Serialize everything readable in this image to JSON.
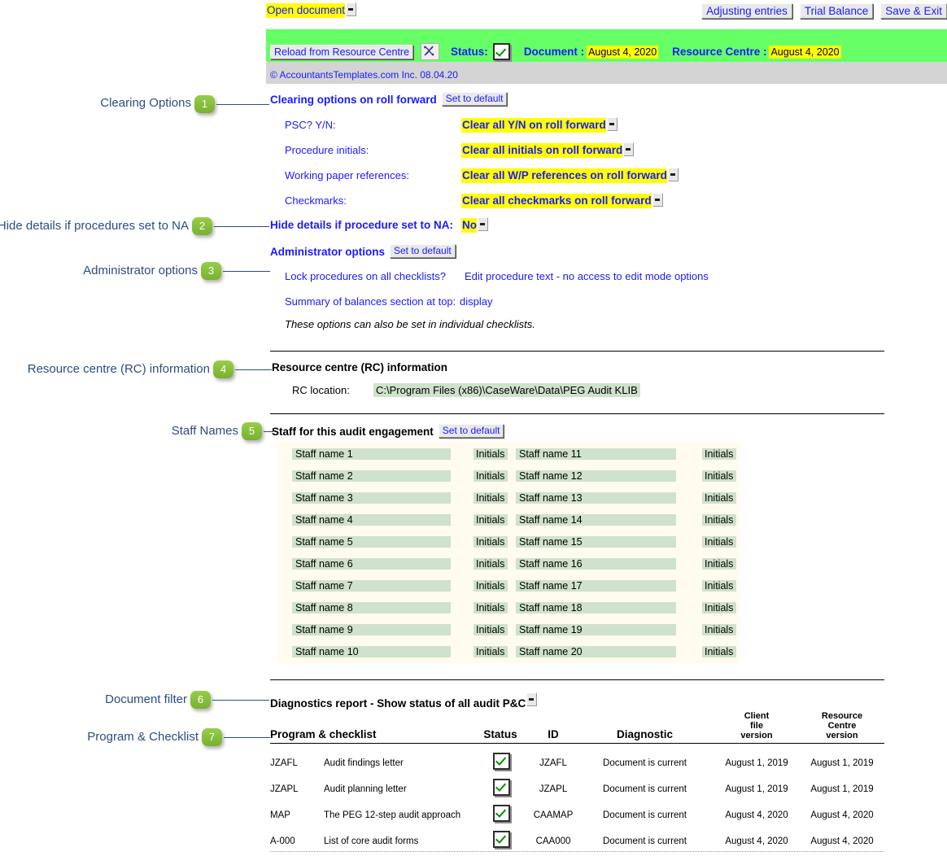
{
  "toolbar": {
    "open_document": "Open document",
    "adjusting_entries": "Adjusting entries",
    "trial_balance": "Trial Balance",
    "save_exit": "Save & Exit"
  },
  "status_band": {
    "reload_button": "Reload from Resource Centre",
    "tool_icon": "dna-helix-icon",
    "status_label": "Status:",
    "status_checked": true,
    "document_label": "Document :",
    "document_date": "August 4, 2020",
    "resource_centre_label": "Resource Centre :",
    "resource_centre_date": "August 4, 2020",
    "copyright": "© AccountantsTemplates.com Inc. 08.04.20",
    "band_color": "#66ff66",
    "highlight_color": "#ffff00"
  },
  "callouts": [
    {
      "n": "1",
      "label": "Clearing Options"
    },
    {
      "n": "2",
      "label": "Hide details if procedures set to NA"
    },
    {
      "n": "3",
      "label": "Administrator options"
    },
    {
      "n": "4",
      "label": "Resource centre (RC) information"
    },
    {
      "n": "5",
      "label": "Staff Names"
    },
    {
      "n": "6",
      "label": "Document filter"
    },
    {
      "n": "7",
      "label": "Program & Checklist"
    }
  ],
  "clearing": {
    "heading": "Clearing options on roll forward",
    "set_default": "Set to default",
    "rows": [
      {
        "label": "PSC? Y/N:",
        "value": "Clear all Y/N on roll forward"
      },
      {
        "label": "Procedure initials:",
        "value": "Clear all initials on roll forward"
      },
      {
        "label": "Working paper references:",
        "value": "Clear all W/P references on roll forward"
      },
      {
        "label": "Checkmarks:",
        "value": "Clear all checkmarks on roll forward"
      }
    ]
  },
  "hide_details": {
    "label": "Hide details if procedure set to NA:",
    "value": "No"
  },
  "admin": {
    "heading": "Administrator options",
    "set_default": "Set to default",
    "rows": [
      {
        "label": "Lock procedures on all checklists?",
        "value": "Edit procedure text - no access to edit mode options"
      },
      {
        "label": "Summary of  balances section at top:",
        "value": "display"
      }
    ],
    "note": "These options can also be set in individual checklists."
  },
  "rc": {
    "heading": "Resource centre (RC) information",
    "location_label": "RC location:",
    "location_value": "C:\\Program Files (x86)\\CaseWare\\Data\\PEG Audit KLIB"
  },
  "staff": {
    "heading": "Staff for this audit engagement",
    "set_default": "Set to default",
    "initials_placeholder": "Initials",
    "left_column": [
      "Staff name 1",
      "Staff name 2",
      "Staff name 3",
      "Staff name 4",
      "Staff name 5",
      "Staff name 6",
      "Staff name 7",
      "Staff name 8",
      "Staff name 9",
      "Staff name 10"
    ],
    "right_column": [
      "Staff name 11",
      "Staff name 12",
      "Staff name 13",
      "Staff name 14",
      "Staff name 15",
      "Staff name 16",
      "Staff name 17",
      "Staff name 18",
      "Staff name 19",
      "Staff name 20"
    ],
    "panel_color": "#fffbee",
    "field_color": "#cfe2cb"
  },
  "diagnostics": {
    "filter_label": "Diagnostics report - Show status of all audit P&C",
    "headers": {
      "program": "Program & checklist",
      "status": "Status",
      "id": "ID",
      "diagnostic": "Diagnostic",
      "client_version": "Client\nfile\nversion",
      "rc_version": "Resource\nCentre\nversion"
    },
    "header_lines": {
      "client_version": [
        "Client",
        "file",
        "version"
      ],
      "rc_version": [
        "Resource",
        "Centre",
        "version"
      ]
    },
    "rows": [
      {
        "code": "JZAFL",
        "name": "Audit findings letter",
        "status": true,
        "id": "JZAFL",
        "diagnostic": "Document is current",
        "client_version": "August 1, 2019",
        "rc_version": "August 1, 2019"
      },
      {
        "code": "JZAPL",
        "name": "Audit planning letter",
        "status": true,
        "id": "JZAPL",
        "diagnostic": "Document is current",
        "client_version": "August 1, 2019",
        "rc_version": "August 1, 2019"
      },
      {
        "code": "MAP",
        "name": "The PEG 12-step audit approach",
        "status": true,
        "id": "CAAMAP",
        "diagnostic": "Document is current",
        "client_version": "August 4, 2020",
        "rc_version": "August 4, 2020"
      },
      {
        "code": "A-000",
        "name": "List of core audit forms",
        "status": true,
        "id": "CAA000",
        "diagnostic": "Document is current",
        "client_version": "August 4, 2020",
        "rc_version": "August 4, 2020"
      }
    ]
  },
  "colors": {
    "link_blue": "#1a1aff",
    "callout_navy": "#2e4d80",
    "badge_green": "#8cc63f",
    "band_green": "#66ff66",
    "highlight_yellow": "#ffff00",
    "field_green": "#cfe2cb",
    "panel_cream": "#fffbee"
  }
}
